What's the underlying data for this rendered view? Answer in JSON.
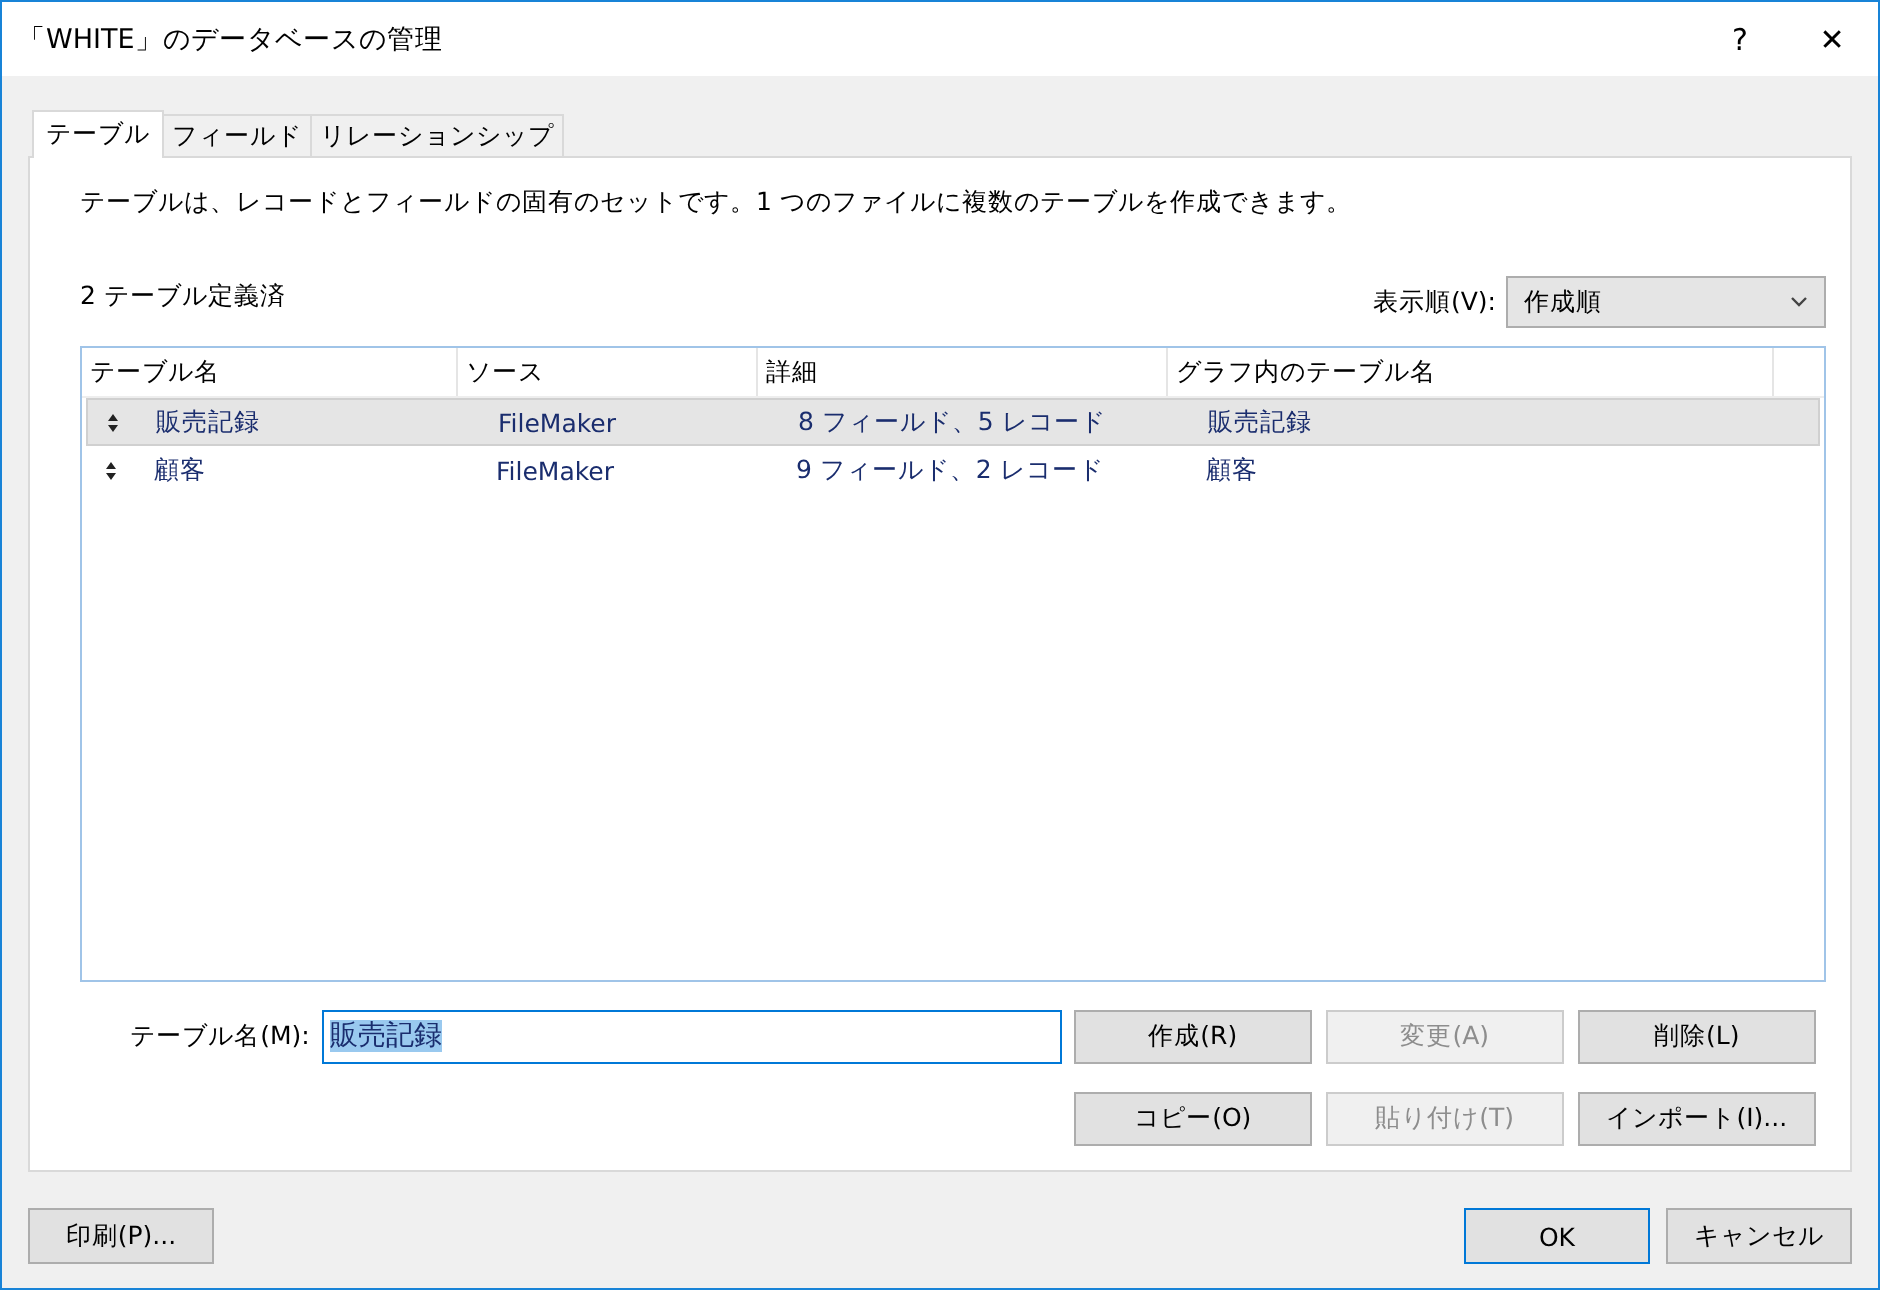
{
  "window": {
    "title": "「WHITE」のデータベースの管理",
    "help": "?",
    "close": "✕"
  },
  "tabs": [
    {
      "label": "テーブル",
      "selected": true
    },
    {
      "label": "フィールド",
      "selected": false
    },
    {
      "label": "リレーションシップ",
      "selected": false
    }
  ],
  "description": "テーブルは、レコードとフィールドの固有のセットです。1 つのファイルに複数のテーブルを作成できます。",
  "count": "2 テーブル定義済",
  "sort": {
    "label": "表示順(V):",
    "value": "作成順"
  },
  "table": {
    "columns": [
      "テーブル名",
      "ソース",
      "詳細",
      "グラフ内のテーブル名"
    ],
    "rows": [
      {
        "cells": [
          "販売記録",
          "FileMaker",
          "8 フィールド、5 レコード",
          "販売記録"
        ],
        "selected": true
      },
      {
        "cells": [
          "顧客",
          "FileMaker",
          "9 フィールド、2 レコード",
          "顧客"
        ],
        "selected": false
      }
    ]
  },
  "name_field": {
    "label": "テーブル名(M):",
    "value": "販売記録"
  },
  "actions": [
    {
      "label": "作成(R)",
      "disabled": false
    },
    {
      "label": "変更(A)",
      "disabled": true
    },
    {
      "label": "削除(L)",
      "disabled": false
    },
    {
      "label": "コピー(O)",
      "disabled": false
    },
    {
      "label": "貼り付け(T)",
      "disabled": true
    },
    {
      "label": "インポート(I)...",
      "disabled": false
    }
  ],
  "print_button": "印刷(P)...",
  "footer_buttons": [
    {
      "label": "OK",
      "default": true
    },
    {
      "label": "キャンセル",
      "default": false
    }
  ]
}
